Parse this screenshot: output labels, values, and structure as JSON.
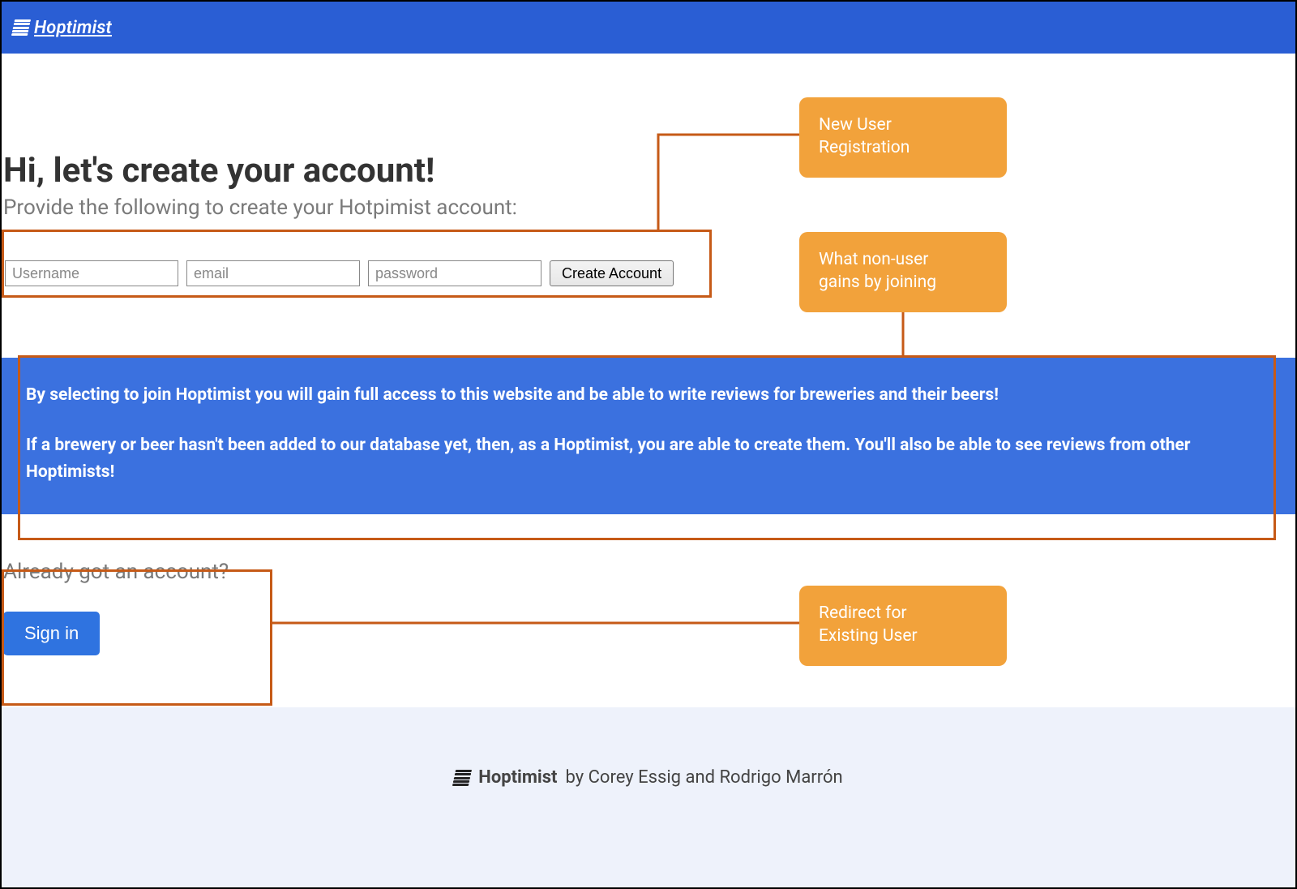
{
  "header": {
    "brand": "Hoptimist"
  },
  "hero": {
    "title": "Hi, let's create your account!",
    "subtitle": "Provide the following to create your Hotpimist account:"
  },
  "form": {
    "username_placeholder": "Username",
    "email_placeholder": "email",
    "password_placeholder": "password",
    "create_label": "Create Account"
  },
  "info": {
    "p1": "By selecting to join Hoptimist you will gain full access to this website and be able to write reviews for breweries and their beers!",
    "p2": "If a brewery or beer hasn't been added to our database yet, then, as a Hoptimist, you are able to create them. You'll also be able to see reviews from other Hoptimists!"
  },
  "existing": {
    "label": "Already got an account?",
    "signin_label": "Sign in"
  },
  "footer": {
    "brand": "Hoptimist",
    "byline": " by Corey Essig and Rodrigo Marrón"
  },
  "annotations": {
    "a1_line1": "New User",
    "a1_line2": "Registration",
    "a2_line1": "What non-user",
    "a2_line2": "gains by joining",
    "a3_line1": "Redirect for",
    "a3_line2": "Existing User"
  },
  "colors": {
    "brand_blue": "#2a5ed4",
    "accent_blue": "#3b71df",
    "callout_orange": "#f2a23b",
    "outline_orange": "#c65a17"
  }
}
